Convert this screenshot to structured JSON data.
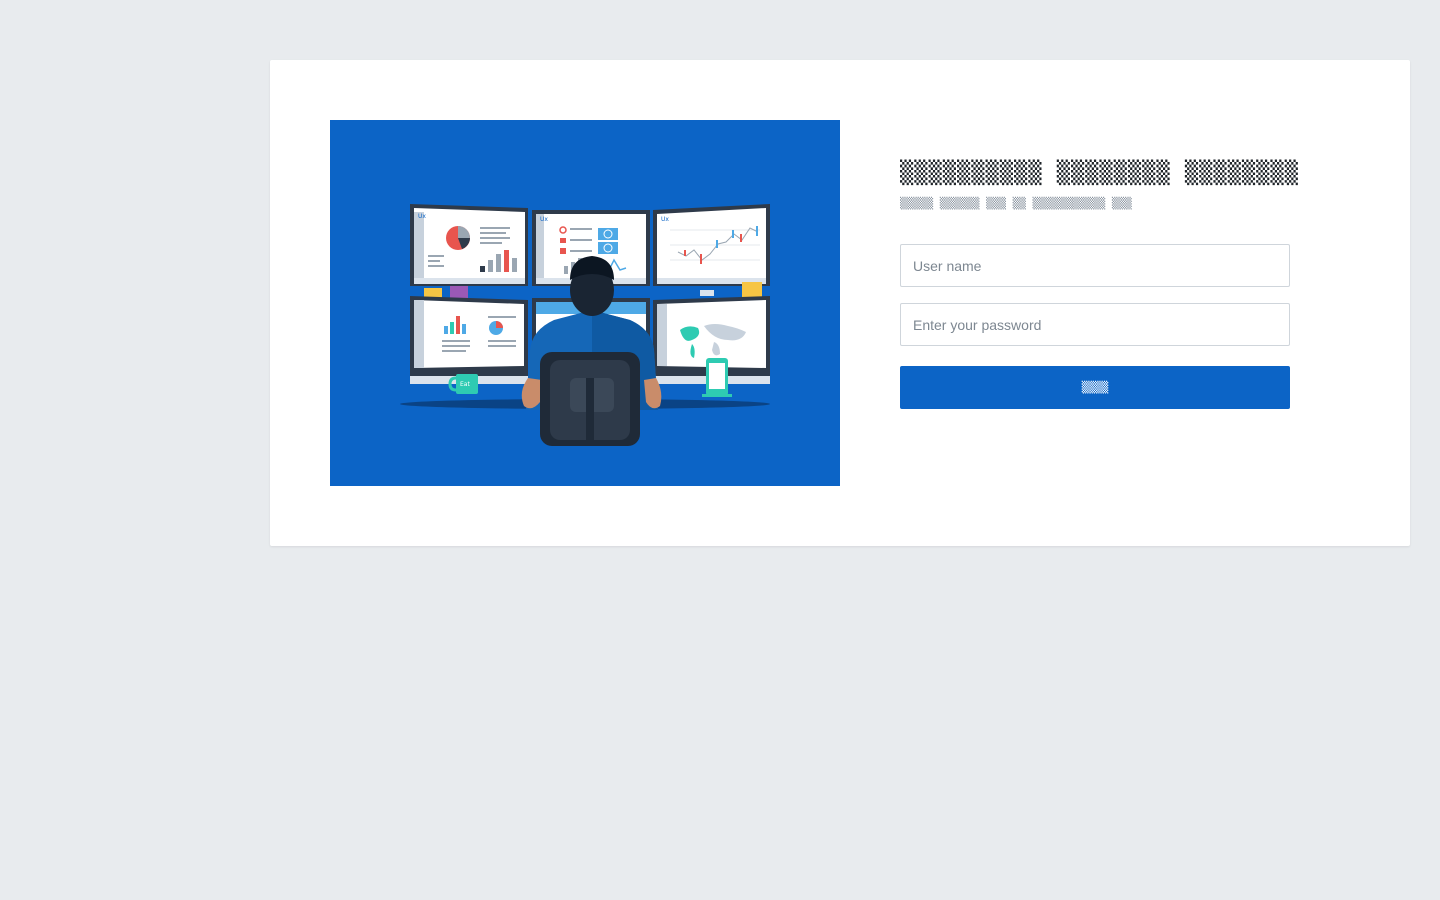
{
  "login": {
    "title": "▒▒▒▒▒▒▒▒▒▒ ▒▒▒▒▒▒▒▒ ▒▒▒▒▒▒▒▒",
    "subtitle": "▒▒▒▒▒ ▒▒▒▒▒▒ ▒▒▒ ▒▒ ▒▒▒▒▒▒▒▒▒▒▒ ▒▒▒",
    "username_placeholder": "User name",
    "password_placeholder": "Enter your password",
    "submit_label": "▒▒▒▒"
  },
  "illustration": {
    "mug_label": "Eat"
  },
  "colors": {
    "page_background": "#e8ebee",
    "card_background": "#ffffff",
    "accent": "#0c64c6",
    "illustration_background": "#0c64c6"
  }
}
